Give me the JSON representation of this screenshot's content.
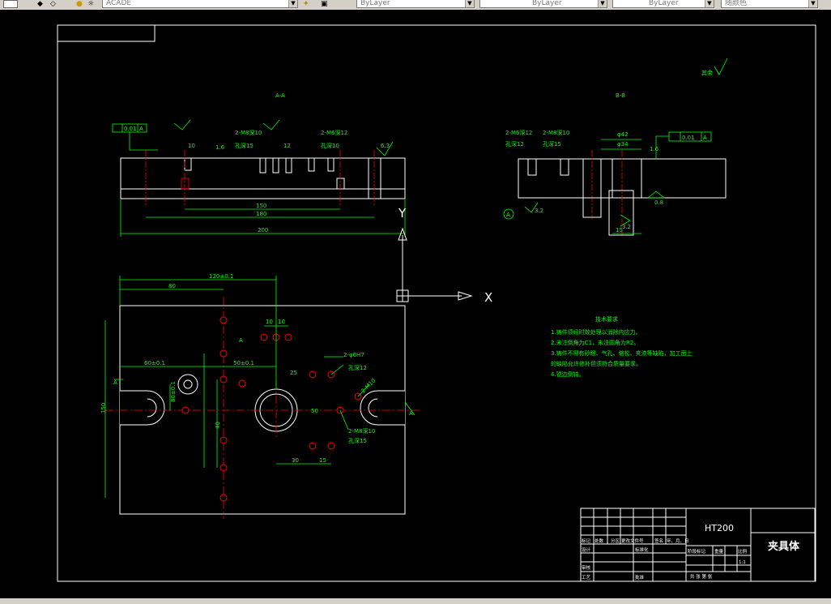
{
  "toolbar": {
    "layer_combo": "ACADE",
    "color_combo": "ByLayer",
    "linetype_combo": "ByLayer",
    "lineweight_combo": "ByLayer",
    "plotstyle_combo": "随颜色"
  },
  "drawing": {
    "section_aa": "A-A",
    "section_bb": "B-B",
    "roughness_note": "其余",
    "ucs_y": "Y",
    "ucs_x": "X",
    "dims": {
      "d150": "150",
      "d180": "180",
      "d200": "200",
      "d80": "80",
      "d120": "120±0.1",
      "d10a": "10",
      "d10b": "10",
      "d30": "30",
      "d15": "15",
      "d40": "40",
      "d25": "25",
      "d50": "50",
      "d42": "φ42",
      "d34": "φ34",
      "d12": "12",
      "d18": "18",
      "r32": "3.2",
      "r63": "6.3",
      "r08": "0.8",
      "r16": "1.6",
      "tol01": "0.01",
      "tol_a": "A",
      "hole_a": "2-M8深10",
      "hole_b": "孔深15",
      "hole_c": "2-M6深12",
      "hole_d": "孔深10",
      "hole_e": "2-φ6H7",
      "hole_f": "2-M10",
      "hole_g": "孔深12",
      "dist_a": "60±0.1",
      "dist_b": "80±0.1",
      "dist_c": "50±0.1"
    },
    "tech_req": {
      "title": "技术要求",
      "lines": [
        "1.铸件须经时效处理以消除内应力。",
        "2.未注倒角为C1，未注圆角为R2。",
        "3.铸件不得有砂眼、气孔、缩松、夹渣等缺陷，加工面上",
        "的缺陷允许修补但须符合质量要求。",
        "4.锐边倒钝。"
      ]
    },
    "title_block": {
      "material": "HT200",
      "part_name": "夹具体",
      "row_labels": [
        "标记",
        "处数",
        "分区",
        "更改文件号",
        "签名",
        "年、月、日"
      ],
      "design": "设计",
      "standardize": "标准化",
      "audit": "审核",
      "process": "工艺",
      "approve": "批准",
      "stage": "阶段标记",
      "weight": "重量",
      "scale": "比例",
      "scale_val": "1:1",
      "sheets": "共  张  第  张"
    }
  },
  "colors": {
    "paper": "#000000",
    "frame": "#ffffff",
    "dimension": "#00ff00",
    "center": "#ff0000",
    "hidden": "#ffff00"
  }
}
